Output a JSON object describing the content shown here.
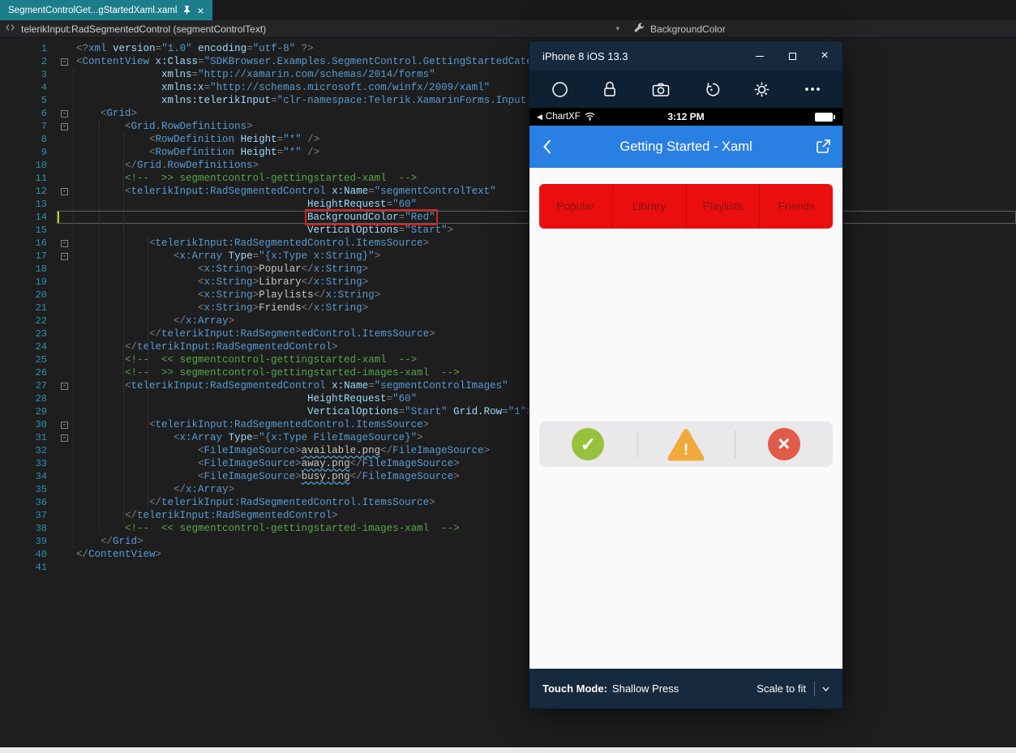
{
  "colors": {
    "tab_active": "#1b7e8a",
    "nav_blue": "#2a7fe3",
    "segment_red": "#eb0e0e",
    "segment_red_text": "#8a1410",
    "icon_green": "#98c23d",
    "icon_amber": "#f2a93b",
    "icon_red": "#e25a4a",
    "highlight_box_red": "#e01b1b",
    "comment_green": "#57a64a",
    "xml_name_blue": "#569cd6",
    "xml_attr_blue": "#9cdcfe",
    "xml_value_blue": "#569cd6",
    "xml_delim_gray": "#808080",
    "line_number_blue": "#2b91af",
    "change_bar": "#b5cc2e"
  },
  "tab_bar": {
    "active_tab": {
      "label": "SegmentControlGet...gStartedXaml.xaml"
    }
  },
  "breadcrumb": {
    "object_dropdown": "telerikInput:RadSegmentedControl (segmentControlText)",
    "member_dropdown": "BackgroundColor"
  },
  "editor": {
    "current_line": 14,
    "changed_lines": [
      14
    ],
    "fold_lines": [
      2,
      6,
      7,
      12,
      16,
      17,
      27,
      30,
      31
    ],
    "lines": [
      [
        [
          "d",
          "<?"
        ],
        [
          "e",
          "xml"
        ],
        [
          "t",
          " "
        ],
        [
          "a",
          "version"
        ],
        [
          "d",
          "="
        ],
        [
          "v",
          "\"1.0\""
        ],
        [
          "t",
          " "
        ],
        [
          "a",
          "encoding"
        ],
        [
          "d",
          "="
        ],
        [
          "v",
          "\"utf-8\""
        ],
        [
          "d",
          " ?>"
        ]
      ],
      [
        [
          "d",
          "<"
        ],
        [
          "e",
          "ContentView"
        ],
        [
          "t",
          " "
        ],
        [
          "a",
          "x:Class"
        ],
        [
          "d",
          "="
        ],
        [
          "v",
          "\"SDKBrowser.Examples.SegmentControl.GettingStartedCategory"
        ]
      ],
      [
        [
          "t",
          "              "
        ],
        [
          "a",
          "xmlns"
        ],
        [
          "d",
          "="
        ],
        [
          "v",
          "\"http://xamarin.com/schemas/2014/forms\""
        ]
      ],
      [
        [
          "t",
          "              "
        ],
        [
          "a",
          "xmlns:x"
        ],
        [
          "d",
          "="
        ],
        [
          "v",
          "\"http://schemas.microsoft.com/winfx/2009/xaml\""
        ]
      ],
      [
        [
          "t",
          "              "
        ],
        [
          "a",
          "xmlns:telerikInput"
        ],
        [
          "d",
          "="
        ],
        [
          "v",
          "\"clr-namespace:Telerik.XamarinForms.Input;assem"
        ]
      ],
      [
        [
          "t",
          "    "
        ],
        [
          "d",
          "<"
        ],
        [
          "e",
          "Grid"
        ],
        [
          "d",
          ">"
        ]
      ],
      [
        [
          "t",
          "        "
        ],
        [
          "d",
          "<"
        ],
        [
          "e",
          "Grid.RowDefinitions"
        ],
        [
          "d",
          ">"
        ]
      ],
      [
        [
          "t",
          "            "
        ],
        [
          "d",
          "<"
        ],
        [
          "e",
          "RowDefinition"
        ],
        [
          "t",
          " "
        ],
        [
          "a",
          "Height"
        ],
        [
          "d",
          "="
        ],
        [
          "v",
          "\"*\""
        ],
        [
          "d",
          " />"
        ]
      ],
      [
        [
          "t",
          "            "
        ],
        [
          "d",
          "<"
        ],
        [
          "e",
          "RowDefinition"
        ],
        [
          "t",
          " "
        ],
        [
          "a",
          "Height"
        ],
        [
          "d",
          "="
        ],
        [
          "v",
          "\"*\""
        ],
        [
          "d",
          " />"
        ]
      ],
      [
        [
          "t",
          "        "
        ],
        [
          "d",
          "</"
        ],
        [
          "e",
          "Grid.RowDefinitions"
        ],
        [
          "d",
          ">"
        ]
      ],
      [
        [
          "t",
          "        "
        ],
        [
          "c",
          "<!--  >> segmentcontrol-gettingstarted-xaml  -->"
        ]
      ],
      [
        [
          "t",
          "        "
        ],
        [
          "d",
          "<"
        ],
        [
          "e",
          "telerikInput:RadSegmentedControl"
        ],
        [
          "t",
          " "
        ],
        [
          "a",
          "x:Name"
        ],
        [
          "d",
          "="
        ],
        [
          "v",
          "\"segmentControlText\""
        ]
      ],
      [
        [
          "t",
          "                                      "
        ],
        [
          "a",
          "HeightRequest"
        ],
        [
          "d",
          "="
        ],
        [
          "v",
          "\"60\""
        ]
      ],
      [
        [
          "t",
          "                                      "
        ],
        [
          "box",
          [
            [
              "a",
              "BackgroundColor"
            ],
            [
              "d",
              "="
            ],
            [
              "v",
              "\"Red\""
            ]
          ]
        ]
      ],
      [
        [
          "t",
          "                                      "
        ],
        [
          "a",
          "VerticalOptions"
        ],
        [
          "d",
          "="
        ],
        [
          "v",
          "\"Start\""
        ],
        [
          "d",
          ">"
        ]
      ],
      [
        [
          "t",
          "            "
        ],
        [
          "d",
          "<"
        ],
        [
          "e",
          "telerikInput:RadSegmentedControl.ItemsSource"
        ],
        [
          "d",
          ">"
        ]
      ],
      [
        [
          "t",
          "                "
        ],
        [
          "d",
          "<"
        ],
        [
          "e",
          "x:Array"
        ],
        [
          "t",
          " "
        ],
        [
          "a",
          "Type"
        ],
        [
          "d",
          "="
        ],
        [
          "v",
          "\"{x:Type x:String}\""
        ],
        [
          "d",
          ">"
        ]
      ],
      [
        [
          "t",
          "                    "
        ],
        [
          "d",
          "<"
        ],
        [
          "e",
          "x:String"
        ],
        [
          "d",
          ">"
        ],
        [
          "t",
          "Popular"
        ],
        [
          "d",
          "</"
        ],
        [
          "e",
          "x:String"
        ],
        [
          "d",
          ">"
        ]
      ],
      [
        [
          "t",
          "                    "
        ],
        [
          "d",
          "<"
        ],
        [
          "e",
          "x:String"
        ],
        [
          "d",
          ">"
        ],
        [
          "t",
          "Library"
        ],
        [
          "d",
          "</"
        ],
        [
          "e",
          "x:String"
        ],
        [
          "d",
          ">"
        ]
      ],
      [
        [
          "t",
          "                    "
        ],
        [
          "d",
          "<"
        ],
        [
          "e",
          "x:String"
        ],
        [
          "d",
          ">"
        ],
        [
          "t",
          "Playlists"
        ],
        [
          "d",
          "</"
        ],
        [
          "e",
          "x:String"
        ],
        [
          "d",
          ">"
        ]
      ],
      [
        [
          "t",
          "                    "
        ],
        [
          "d",
          "<"
        ],
        [
          "e",
          "x:String"
        ],
        [
          "d",
          ">"
        ],
        [
          "t",
          "Friends"
        ],
        [
          "d",
          "</"
        ],
        [
          "e",
          "x:String"
        ],
        [
          "d",
          ">"
        ]
      ],
      [
        [
          "t",
          "                "
        ],
        [
          "d",
          "</"
        ],
        [
          "e",
          "x:Array"
        ],
        [
          "d",
          ">"
        ]
      ],
      [
        [
          "t",
          "            "
        ],
        [
          "d",
          "</"
        ],
        [
          "e",
          "telerikInput:RadSegmentedControl.ItemsSource"
        ],
        [
          "d",
          ">"
        ]
      ],
      [
        [
          "t",
          "        "
        ],
        [
          "d",
          "</"
        ],
        [
          "e",
          "telerikInput:RadSegmentedControl"
        ],
        [
          "d",
          ">"
        ]
      ],
      [
        [
          "t",
          "        "
        ],
        [
          "c",
          "<!--  << segmentcontrol-gettingstarted-xaml  -->"
        ]
      ],
      [
        [
          "t",
          "        "
        ],
        [
          "c",
          "<!--  >> segmentcontrol-gettingstarted-images-xaml  -->"
        ]
      ],
      [
        [
          "t",
          "        "
        ],
        [
          "d",
          "<"
        ],
        [
          "e",
          "telerikInput:RadSegmentedControl"
        ],
        [
          "t",
          " "
        ],
        [
          "a",
          "x:Name"
        ],
        [
          "d",
          "="
        ],
        [
          "v",
          "\"segmentControlImages\""
        ]
      ],
      [
        [
          "t",
          "                                      "
        ],
        [
          "a",
          "HeightRequest"
        ],
        [
          "d",
          "="
        ],
        [
          "v",
          "\"60\""
        ]
      ],
      [
        [
          "t",
          "                                      "
        ],
        [
          "a",
          "VerticalOptions"
        ],
        [
          "d",
          "="
        ],
        [
          "v",
          "\"Start\""
        ],
        [
          "t",
          " "
        ],
        [
          "a",
          "Grid.Row"
        ],
        [
          "d",
          "="
        ],
        [
          "v",
          "\"1\""
        ],
        [
          "d",
          ">"
        ]
      ],
      [
        [
          "t",
          "            "
        ],
        [
          "d",
          "<"
        ],
        [
          "e",
          "telerikInput:RadSegmentedControl.ItemsSource"
        ],
        [
          "d",
          ">"
        ]
      ],
      [
        [
          "t",
          "                "
        ],
        [
          "d",
          "<"
        ],
        [
          "e",
          "x:Array"
        ],
        [
          "t",
          " "
        ],
        [
          "a",
          "Type"
        ],
        [
          "d",
          "="
        ],
        [
          "v",
          "\"{x:Type FileImageSource}\""
        ],
        [
          "d",
          ">"
        ]
      ],
      [
        [
          "t",
          "                    "
        ],
        [
          "d",
          "<"
        ],
        [
          "e",
          "FileImageSource"
        ],
        [
          "d",
          ">"
        ],
        [
          "u",
          "available.png"
        ],
        [
          "d",
          "</"
        ],
        [
          "e",
          "FileImageSource"
        ],
        [
          "d",
          ">"
        ]
      ],
      [
        [
          "t",
          "                    "
        ],
        [
          "d",
          "<"
        ],
        [
          "e",
          "FileImageSource"
        ],
        [
          "d",
          ">"
        ],
        [
          "u",
          "away.png"
        ],
        [
          "d",
          "</"
        ],
        [
          "e",
          "FileImageSource"
        ],
        [
          "d",
          ">"
        ]
      ],
      [
        [
          "t",
          "                    "
        ],
        [
          "d",
          "<"
        ],
        [
          "e",
          "FileImageSource"
        ],
        [
          "d",
          ">"
        ],
        [
          "u",
          "busy.png"
        ],
        [
          "d",
          "</"
        ],
        [
          "e",
          "FileImageSource"
        ],
        [
          "d",
          ">"
        ]
      ],
      [
        [
          "t",
          "                "
        ],
        [
          "d",
          "</"
        ],
        [
          "e",
          "x:Array"
        ],
        [
          "d",
          ">"
        ]
      ],
      [
        [
          "t",
          "            "
        ],
        [
          "d",
          "</"
        ],
        [
          "e",
          "telerikInput:RadSegmentedControl.ItemsSource"
        ],
        [
          "d",
          ">"
        ]
      ],
      [
        [
          "t",
          "        "
        ],
        [
          "d",
          "</"
        ],
        [
          "e",
          "telerikInput:RadSegmentedControl"
        ],
        [
          "d",
          ">"
        ]
      ],
      [
        [
          "t",
          "        "
        ],
        [
          "c",
          "<!--  << segmentcontrol-gettingstarted-images-xaml  -->"
        ]
      ],
      [
        [
          "t",
          "    "
        ],
        [
          "d",
          "</"
        ],
        [
          "e",
          "Grid"
        ],
        [
          "d",
          ">"
        ]
      ],
      [
        [
          "d",
          "</"
        ],
        [
          "e",
          "ContentView"
        ],
        [
          "d",
          ">"
        ]
      ],
      []
    ]
  },
  "simulator": {
    "title": "iPhone 8 iOS 13.3",
    "toolbar_icons": [
      "home-circle-icon",
      "lock-icon",
      "camera-icon",
      "rotate-icon",
      "settings-gear-icon",
      "more-options-icon"
    ],
    "status_bar": {
      "back_indicator": "◀",
      "carrier": "ChartXF",
      "time": "3:12 PM"
    },
    "nav_bar": {
      "title": "Getting Started - Xaml"
    },
    "segmented_text_items": [
      "Popular",
      "Library",
      "Playlists",
      "Friends"
    ],
    "segmented_icon_items": [
      "check",
      "warning",
      "close"
    ],
    "bottom_bar": {
      "label": "Touch Mode:",
      "value": "Shallow Press",
      "scale": "Scale to fit"
    }
  }
}
